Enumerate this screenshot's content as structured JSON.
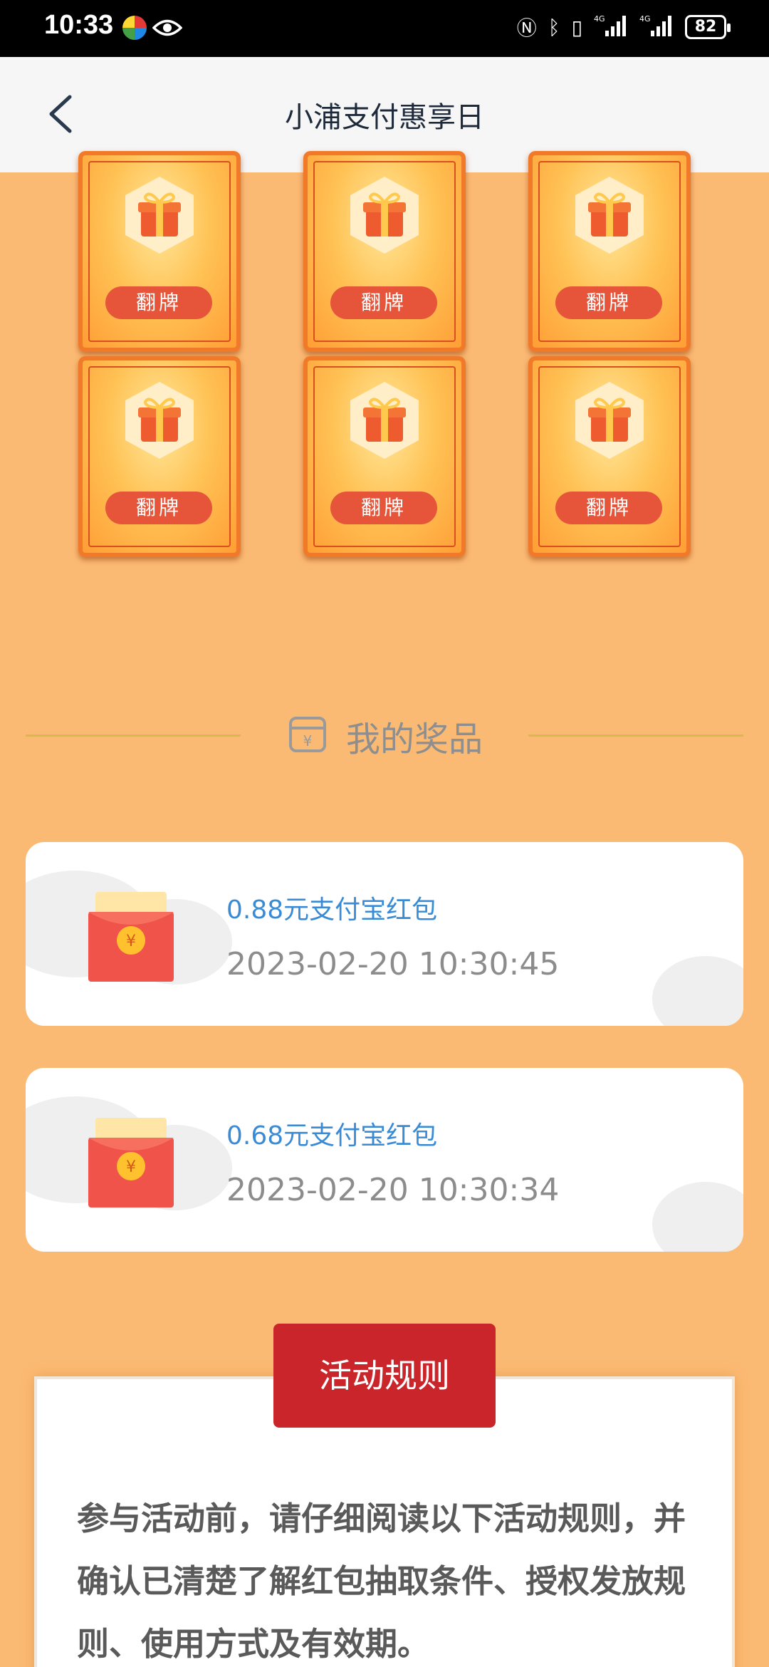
{
  "status_bar": {
    "time": "10:33",
    "icons": [
      "pinwheel-icon",
      "eye-icon",
      "nfc-icon",
      "bluetooth-icon",
      "vibrate-icon",
      "signal-4g-icon",
      "signal-4g-icon"
    ],
    "battery": "82"
  },
  "nav": {
    "title": "小浦支付惠享日",
    "back_icon": "chevron-left-icon"
  },
  "cards": {
    "label": "翻牌",
    "icon": "gift-icon"
  },
  "prizes_section": {
    "title": "我的奖品",
    "icon": "ticket-yuan-icon"
  },
  "prizes": [
    {
      "name": "0.88元支付宝红包",
      "time": "2023-02-20 10:30:45"
    },
    {
      "name": "0.68元支付宝红包",
      "time": "2023-02-20 10:30:34"
    }
  ],
  "rules": {
    "button": "活动规则",
    "text": "参与活动前，请仔细阅读以下活动规则，并确认已清楚了解红包抽取条件、授权发放规则、使用方式及有效期。"
  },
  "colors": {
    "background": "#FBBA73",
    "prize_name": "#3A8BD6",
    "rules_button": "#C9252B"
  }
}
